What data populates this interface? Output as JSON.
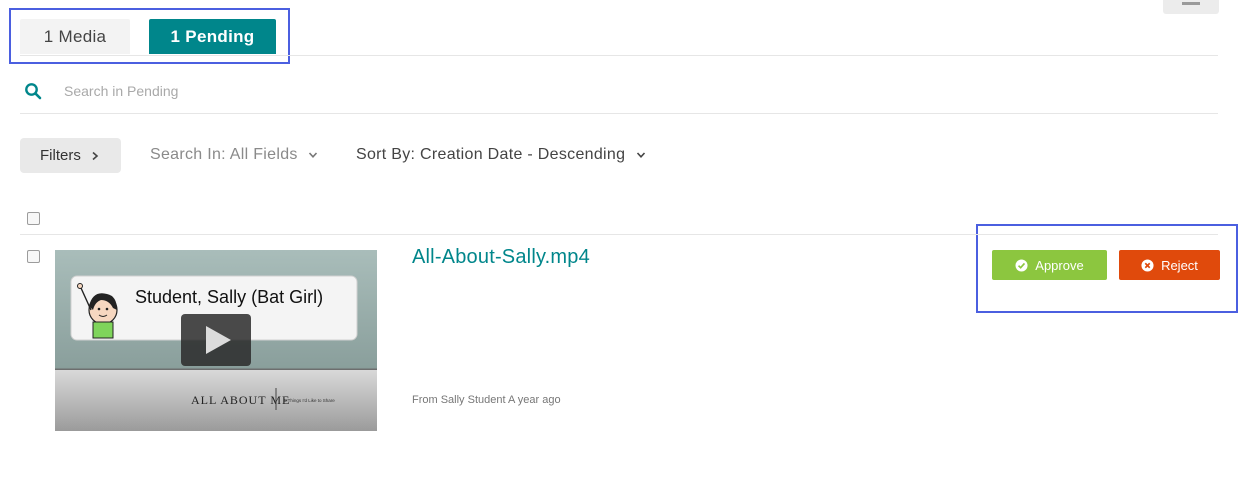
{
  "tabs": {
    "media_label": "1 Media",
    "pending_label": "1 Pending"
  },
  "search": {
    "placeholder": "Search in Pending",
    "value": ""
  },
  "filters": {
    "button_label": "Filters",
    "search_in": "Search In: All Fields",
    "sort_by": "Sort By: Creation Date - Descending"
  },
  "entry": {
    "title": "All-About-Sally.mp4",
    "meta": "From Sally Student A year ago",
    "thumbnail": {
      "name_card": "Student, Sally (Bat Girl)",
      "banner": "ALL ABOUT ME",
      "tagline": "5 Things I'd Like to Share"
    },
    "approve_label": "Approve",
    "reject_label": "Reject"
  },
  "colors": {
    "accent": "#00868b",
    "approve": "#8cc63f",
    "reject": "#e04a0c",
    "highlight": "#4b5fe0"
  },
  "icons": [
    "search-icon",
    "chevron-right-icon",
    "chevron-down-icon",
    "play-icon",
    "check-circle-icon",
    "x-circle-icon",
    "menu-icon"
  ]
}
